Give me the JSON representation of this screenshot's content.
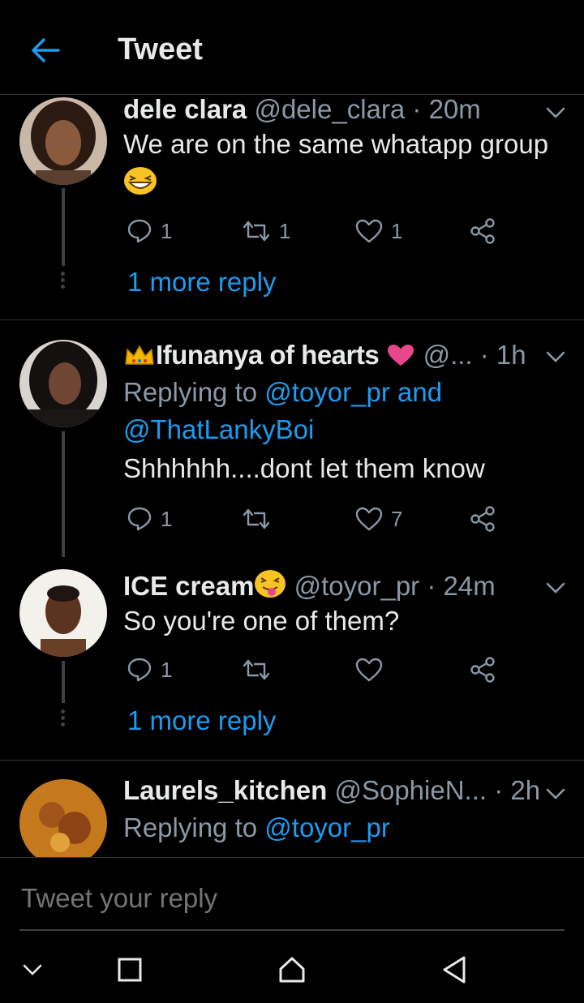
{
  "header": {
    "title": "Tweet"
  },
  "tweets": [
    {
      "name": "dele clara",
      "handle": "@dele_clara",
      "time": "· 20m",
      "text_line1": "We are on the same whatapp group",
      "emoji": "grinning-squinting-face",
      "replies": "1",
      "retweets": "1",
      "likes": "1",
      "more": "1 more reply"
    },
    {
      "name": "Ifunanya of hearts",
      "name_prefix_emoji": "crown",
      "name_suffix_emoji": "pink-heart",
      "handle": "@...",
      "time": "· 1h",
      "replying_label": "Replying to",
      "reply_mention1": "@toyor_pr and",
      "reply_mention2": "@ThatLankyBoi",
      "text": "Shhhhhh....dont let them know",
      "replies": "1",
      "retweets": "",
      "likes": "7"
    },
    {
      "name": "ICE cream",
      "name_suffix_emoji": "squinting-tongue-face",
      "handle": "@toyor_pr",
      "time": "· 24m",
      "text": "So you're one of them?",
      "replies": "1",
      "retweets": "",
      "likes": "",
      "more": "1 more reply"
    },
    {
      "name": "Laurels_kitchen",
      "handle": "@SophieN...",
      "time": "· 2h",
      "replying_label": "Replying to",
      "reply_mention1": "@toyor_pr"
    }
  ],
  "compose": {
    "placeholder": "Tweet your reply"
  },
  "colors": {
    "accent": "#1d9bf0",
    "muted": "#8b98a5",
    "text": "#e7e9ea",
    "background": "#000000"
  }
}
